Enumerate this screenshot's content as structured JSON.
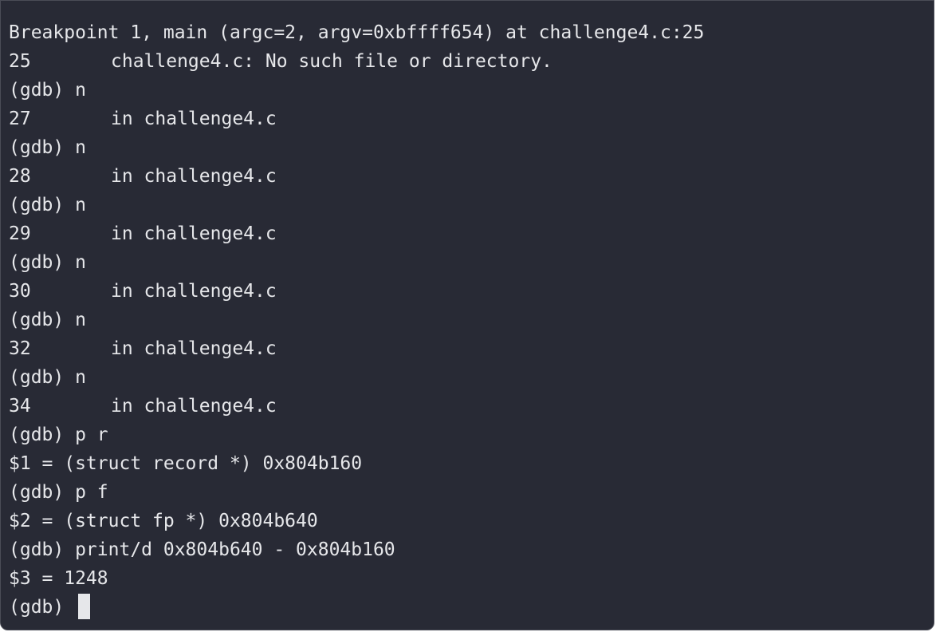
{
  "terminal": {
    "lines": [
      {
        "kind": "text",
        "text": "Breakpoint 1, main (argc=2, argv=0xbffff654) at challenge4.c:25"
      },
      {
        "kind": "src",
        "num": "25",
        "text": "challenge4.c: No such file or directory."
      },
      {
        "kind": "text",
        "text": "(gdb) n"
      },
      {
        "kind": "src",
        "num": "27",
        "text": "in challenge4.c"
      },
      {
        "kind": "text",
        "text": "(gdb) n"
      },
      {
        "kind": "src",
        "num": "28",
        "text": "in challenge4.c"
      },
      {
        "kind": "text",
        "text": "(gdb) n"
      },
      {
        "kind": "src",
        "num": "29",
        "text": "in challenge4.c"
      },
      {
        "kind": "text",
        "text": "(gdb) n"
      },
      {
        "kind": "src",
        "num": "30",
        "text": "in challenge4.c"
      },
      {
        "kind": "text",
        "text": "(gdb) n"
      },
      {
        "kind": "src",
        "num": "32",
        "text": "in challenge4.c"
      },
      {
        "kind": "text",
        "text": "(gdb) n"
      },
      {
        "kind": "src",
        "num": "34",
        "text": "in challenge4.c"
      },
      {
        "kind": "text",
        "text": "(gdb) p r"
      },
      {
        "kind": "text",
        "text": "$1 = (struct record *) 0x804b160"
      },
      {
        "kind": "text",
        "text": "(gdb) p f"
      },
      {
        "kind": "text",
        "text": "$2 = (struct fp *) 0x804b640"
      },
      {
        "kind": "text",
        "text": "(gdb) print/d 0x804b640 - 0x804b160"
      },
      {
        "kind": "text",
        "text": "$3 = 1248"
      }
    ],
    "prompt": "(gdb) "
  }
}
